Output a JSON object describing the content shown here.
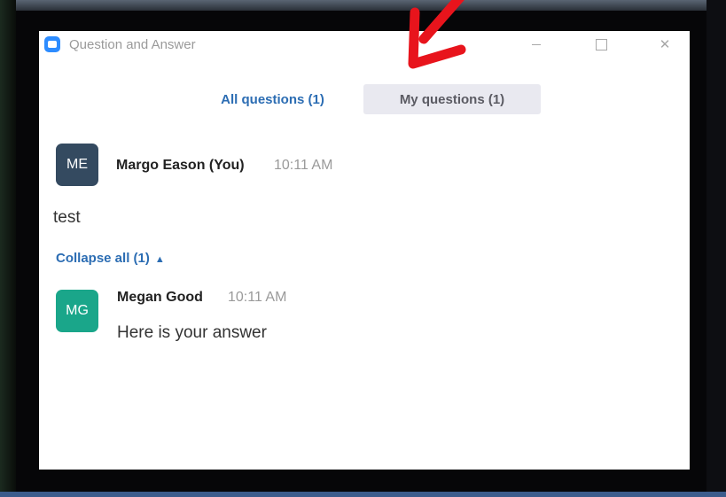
{
  "window": {
    "title": "Question and Answer"
  },
  "tabs": [
    {
      "label": "All questions (1)",
      "active": true
    },
    {
      "label": "My questions (1)",
      "active": false
    }
  ],
  "question": {
    "avatar_initials": "ME",
    "author": "Margo Eason (You)",
    "time": "10:11 AM",
    "text": "test",
    "collapse_label": "Collapse all (1)"
  },
  "answer": {
    "avatar_initials": "MG",
    "author": "Megan Good",
    "time": "10:11 AM",
    "text": "Here is your answer"
  },
  "colors": {
    "accent": "#2c6db3",
    "avatar_me": "#344a60",
    "avatar_mg": "#1aa68a",
    "annotation_arrow": "#e8141c"
  },
  "icons": {
    "app": "zoom-app-icon",
    "minimize": "minimize-icon",
    "maximize": "maximize-icon",
    "close": "close-icon",
    "collapse": "chevron-up-icon",
    "annotation": "red-arrow-icon"
  }
}
